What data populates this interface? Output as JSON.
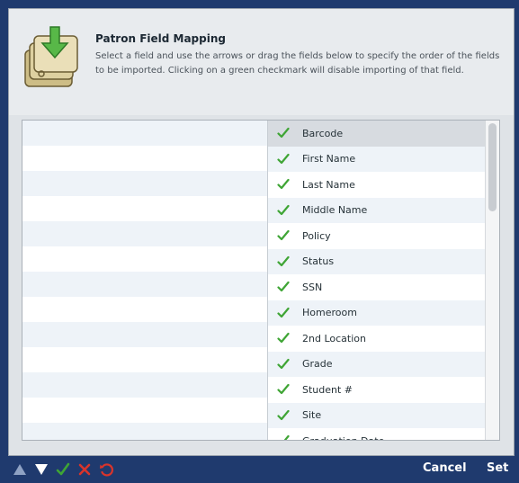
{
  "header": {
    "title": "Patron Field Mapping",
    "description": "Select a field and use the arrows or drag the fields below to specify the order of the fields to be imported. Clicking on a green checkmark will disable importing of that field."
  },
  "fields": [
    {
      "label": "Barcode",
      "enabled": true,
      "selected": true
    },
    {
      "label": "First Name",
      "enabled": true
    },
    {
      "label": "Last Name",
      "enabled": true
    },
    {
      "label": "Middle Name",
      "enabled": true
    },
    {
      "label": "Policy",
      "enabled": true
    },
    {
      "label": "Status",
      "enabled": true
    },
    {
      "label": "SSN",
      "enabled": true
    },
    {
      "label": "Homeroom",
      "enabled": true
    },
    {
      "label": "2nd Location",
      "enabled": true
    },
    {
      "label": "Grade",
      "enabled": true
    },
    {
      "label": "Student #",
      "enabled": true
    },
    {
      "label": "Site",
      "enabled": true
    },
    {
      "label": "Graduation Date",
      "enabled": true
    }
  ],
  "footer": {
    "cancel_label": "Cancel",
    "set_label": "Set"
  },
  "colors": {
    "check_green": "#3fa535",
    "footer_bg": "#1f3a6e",
    "disable_red": "#d9342b"
  }
}
